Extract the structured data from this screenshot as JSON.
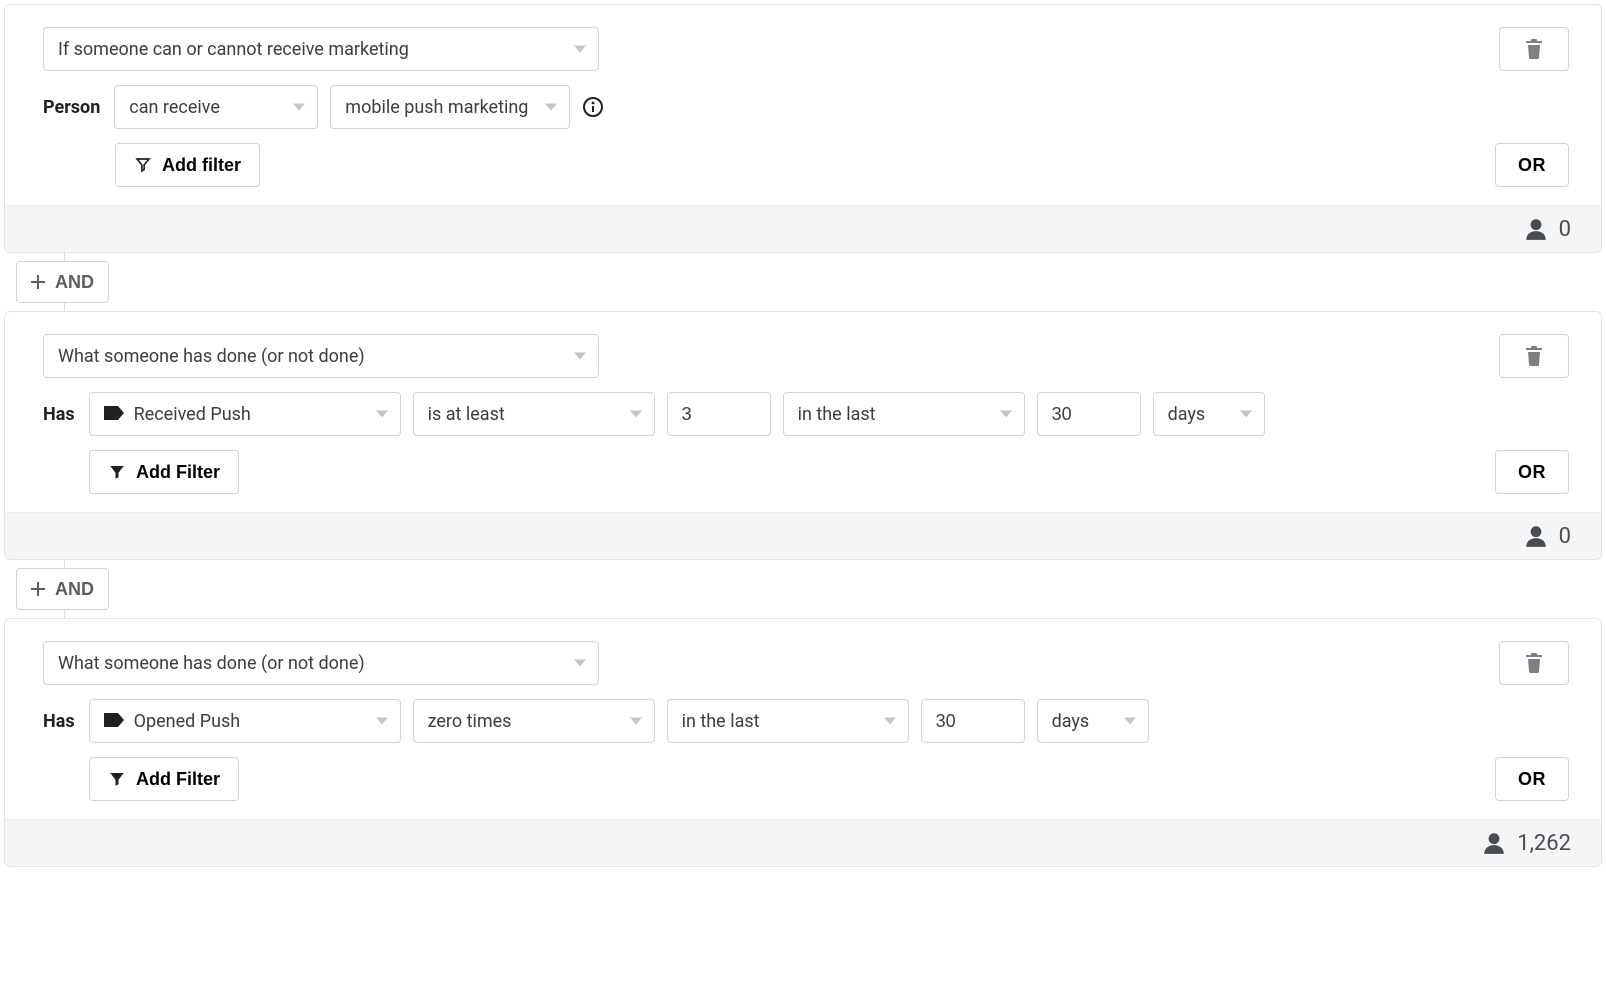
{
  "common": {
    "add_filter_label": "Add Filter",
    "add_filter_label_lc": "Add filter",
    "or_label": "OR",
    "and_label": "AND",
    "has_label": "Has",
    "person_label": "Person"
  },
  "block1": {
    "type_label": "If someone can or cannot receive marketing",
    "can_receive_label": "can receive",
    "channel_label": "mobile push marketing",
    "count": "0"
  },
  "block2": {
    "type_label": "What someone has done (or not done)",
    "event_label": "Received Push",
    "comparator_label": "is at least",
    "value": "3",
    "timeframe_label": "in the last",
    "time_value": "30",
    "time_unit": "days",
    "count": "0"
  },
  "block3": {
    "type_label": "What someone has done (or not done)",
    "event_label": "Opened Push",
    "comparator_label": "zero times",
    "timeframe_label": "in the last",
    "time_value": "30",
    "time_unit": "days",
    "count": "1,262"
  }
}
